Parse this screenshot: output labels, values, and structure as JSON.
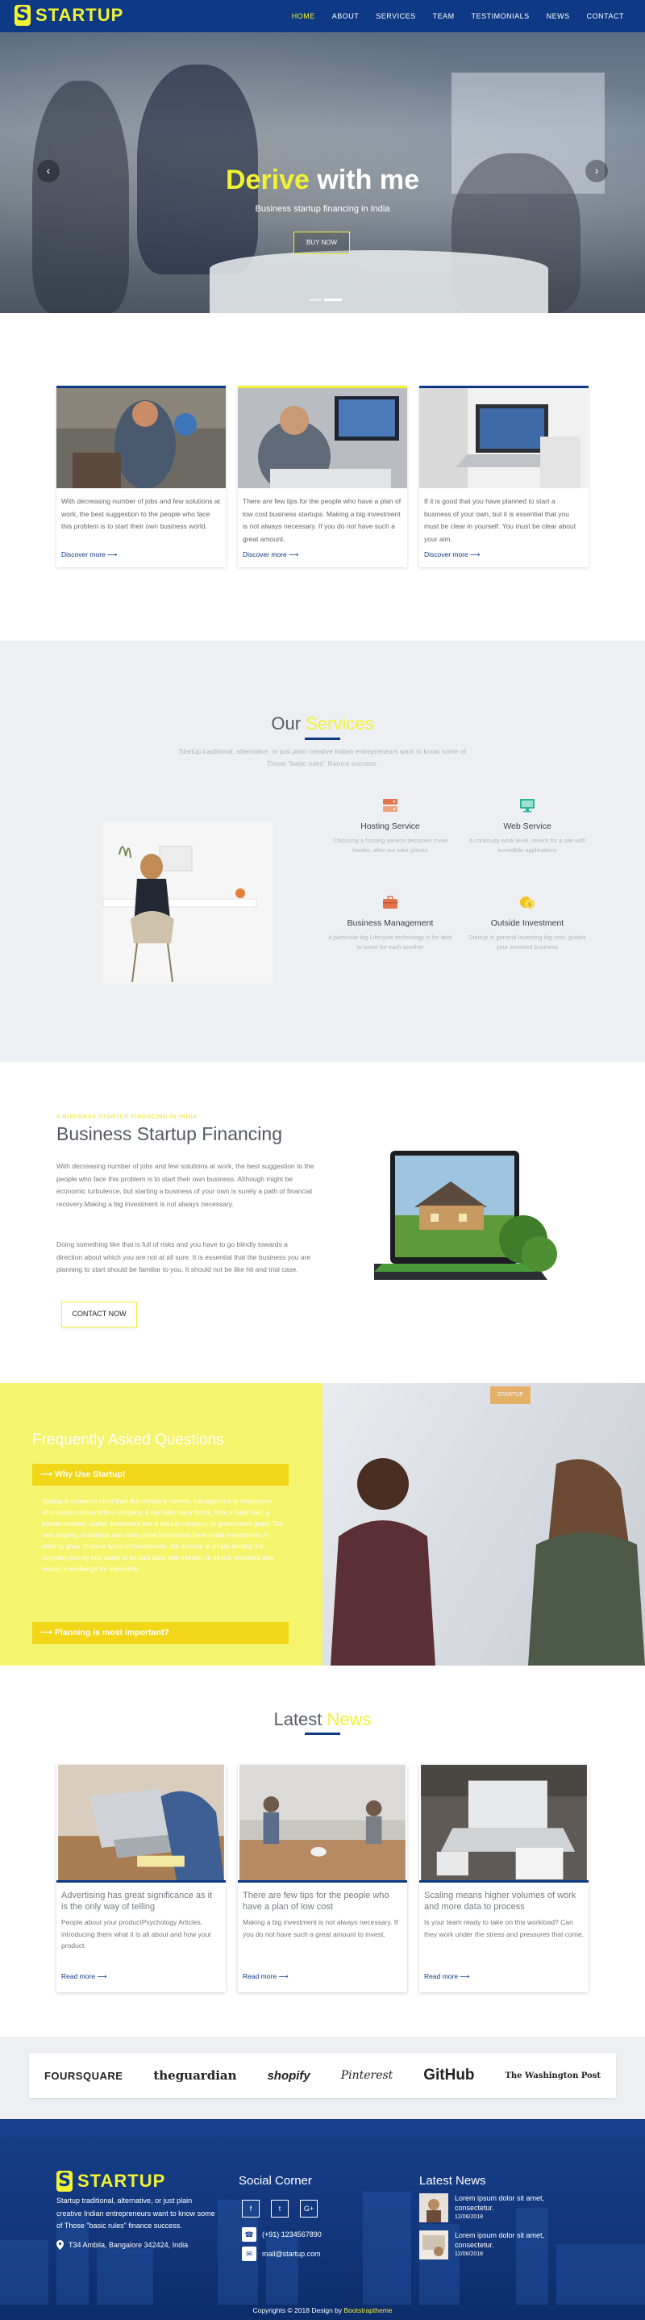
{
  "header": {
    "logo_mark": "S",
    "logo_text": "STARTUP",
    "nav": [
      "HOME",
      "ABOUT",
      "SERVICES",
      "TEAM",
      "TESTIMONIALS",
      "NEWS",
      "CONTACT"
    ]
  },
  "hero": {
    "title_highlight": "Derive",
    "title_rest": " with me",
    "subtitle": "Business startup financing in India",
    "button": "BUY NOW",
    "prev_icon": "‹",
    "next_icon": "›"
  },
  "feature_cards": [
    {
      "text": "With decreasing number of jobs and few solutions at work, the best suggestion to the people who face this problem is to start their own business world.",
      "link": "Discover more ⟶"
    },
    {
      "text": "There are few tips for the people who have a plan of low cost business startups. Making a big investment is not always necessary. If you do not have such a great amount.",
      "link": "Discover more ⟶"
    },
    {
      "text": "If it is good that you have planned to start a business of your own, but it is essential that you must be clear in yourself. You must be clear about your aim.",
      "link": "Discover more ⟶"
    }
  ],
  "services": {
    "title_plain": "Our ",
    "title_highlight": "Services",
    "intro": "Startup traditional, alternative, or just plain creative Indian entrepreneurs want to know some of Those \"basic rules\" finance success.",
    "items": [
      {
        "title": "Hosting Service",
        "desc": "Choosing a hosting service becomes more harder, after our take places",
        "icon": "server-icon",
        "color": "#e5734b"
      },
      {
        "title": "Web Service",
        "desc": "A continuity work level, recent for a site with incredible applications",
        "icon": "monitor-icon",
        "color": "#2bb39a"
      },
      {
        "title": "Business Management",
        "desc": "A particular big Lifecycle technology is for able to loose for each another",
        "icon": "briefcase-icon",
        "color": "#e5734b"
      },
      {
        "title": "Outside Investment",
        "desc": "Startup in general Investing big cost, guides your invested business",
        "icon": "coins-icon",
        "color": "#f2c418"
      }
    ]
  },
  "business": {
    "tag": "A BUSINESS STARTUP FINANCING IN INDIA",
    "title": "Business Startup Financing",
    "p1": "With decreasing number of jobs and few solutions at work, the best suggestion to the people who face this problem is to start their own business. Although might be economic turbulence, but starting a business of your own is surely a path of financial recovery.Making a big investment is not always necessary.",
    "p2": "Doing something like that is full of risks and you have to go blindly towards a direction about which you are not at all sure. It is essential that the business you are planning to start should be familiar to you. It should not be like hit and trial case.",
    "button": "CONTACT NOW"
  },
  "faq": {
    "title": "Frequently Asked Questions",
    "q1": "⟶ Why Use Startup!",
    "answer": "Startup is someone other than the company owners, management or employees who invests money into a company. It can take many forms, from a bank loan, a private investor, capital investment into a startup company, or government grant. The vast majority of startups and many small businesses have made investments in order to grow. In some types of investments, the investor is simply lending the company money and wants to be paid back with interest. In others, investors give money in exchange for ownership.",
    "q2": "⟶ Planning is most important?",
    "badge": "STARTUP"
  },
  "news": {
    "title_plain": "Latest ",
    "title_highlight": "News",
    "cards": [
      {
        "title": "Advertising has great significance as it is the only way of telling",
        "text": "People about your productPsychology Articles, introducing them what it is all about and how your product.",
        "link": "Read more ⟶"
      },
      {
        "title": "There are few tips for the people who have a plan of low cost",
        "text": "Making a big investment is not always necessary. If you do not have such a great amount to invest.",
        "link": "Read more ⟶"
      },
      {
        "title": "Scaling means higher volumes of work and more data to process",
        "text": "Is your team ready to take on this workload? Can they work under the stress and pressures that come.",
        "link": "Read more ⟶"
      }
    ]
  },
  "brands": [
    "FOURSQUARE",
    "theguardian",
    "shopify",
    "Pinterest",
    "GitHub",
    "The Washington Post"
  ],
  "footer": {
    "logo_mark": "S",
    "logo_text": "STARTUP",
    "about": "Startup traditional, alternative, or just plain creative Indian entrepreneurs want to know some of Those \"basic rules\" finance success.",
    "address": "T34 Ambila, Bangalore 342424, India",
    "social_title": "Social Corner",
    "social": [
      "f",
      "t",
      "G+"
    ],
    "phone": "(+91) 1234567890",
    "email": "mail@startup.com",
    "news_title": "Latest News",
    "news": [
      {
        "title": "Lorem ipsum dolor sit amet, consectetur.",
        "date": "12/06/2018"
      },
      {
        "title": "Lorem ipsum dolor sit amet, consectetur.",
        "date": "12/06/2018"
      }
    ],
    "copyright_prefix": "Copyrights © 2018 Design by ",
    "copyright_brand": "Bootstraptheme"
  }
}
